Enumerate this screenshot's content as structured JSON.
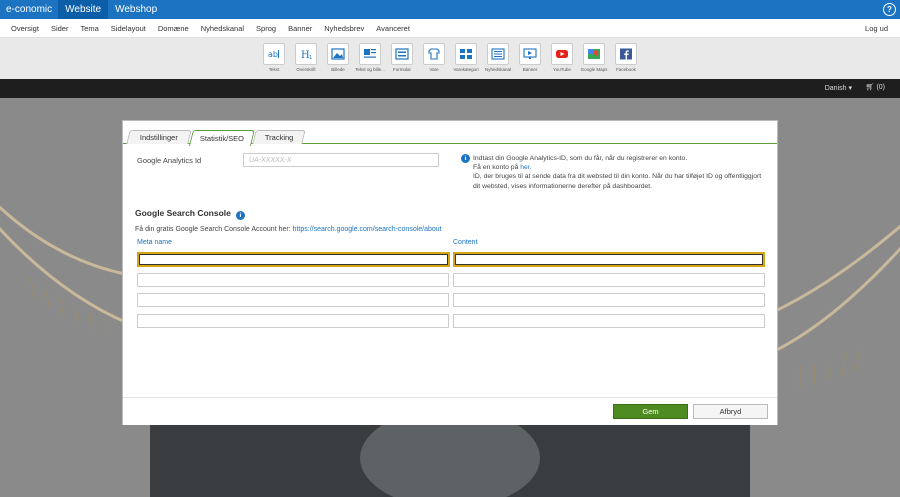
{
  "topbar": {
    "brand": "e-conomic",
    "tabs": [
      "Website",
      "Webshop"
    ],
    "help_glyph": "?"
  },
  "subnav": {
    "items": [
      "Oversigt",
      "Sider",
      "Tema",
      "Sidelayout",
      "Domæne",
      "Nyhedskanal",
      "Sprog",
      "Banner",
      "Nyhedsbrev",
      "Avanceret"
    ],
    "logout": "Log ud"
  },
  "toolbar": {
    "tools": [
      {
        "label": "Tekst",
        "icon": "text-icon"
      },
      {
        "label": "Overskrift",
        "icon": "heading-icon"
      },
      {
        "label": "Billede",
        "icon": "image-icon"
      },
      {
        "label": "Tekst og bille...",
        "icon": "text-image-icon"
      },
      {
        "label": "Formular",
        "icon": "form-icon"
      },
      {
        "label": "Vare",
        "icon": "product-icon"
      },
      {
        "label": "Varekategori",
        "icon": "category-icon"
      },
      {
        "label": "Nyhedskanal",
        "icon": "news-icon"
      },
      {
        "label": "Banner",
        "icon": "banner-icon"
      },
      {
        "label": "YouTube",
        "icon": "youtube-icon"
      },
      {
        "label": "Google Maps",
        "icon": "maps-icon"
      },
      {
        "label": "Facebook",
        "icon": "facebook-icon"
      }
    ]
  },
  "sitehead": {
    "language": "Danish",
    "cart_count": "(0)"
  },
  "modal": {
    "tabs": [
      "Indstillinger",
      "Statistik/SEO",
      "Tracking"
    ],
    "analytics_label": "Google Analytics Id",
    "analytics_placeholder": "UA-XXXXX-X",
    "info_glyph": "i",
    "info_line1": "Indtast din Google Analytics-ID, som du får, når du registrerer en konto.",
    "info_line2_pre": "Få en konto på ",
    "info_line2_link": "her",
    "info_line2_post": ".",
    "info_line3": "ID, der bruges til at sende data fra dit websted til din konto. Når du har tilføjet ID og offentliggjort dit websted, vises informationerne derefter på dashboardet.",
    "gsc_title": "Google Search Console",
    "gsc_account_text": "Få din gratis Google Search Console Account her: ",
    "gsc_link": "https://search.google.com/search-console/about",
    "col_meta": "Meta name",
    "col_content": "Content",
    "save": "Gem",
    "cancel": "Afbryd"
  },
  "colors": {
    "topbar": "#1c73c2",
    "accent_green": "#5c9e3a",
    "save_button": "#4e8b21",
    "link": "#1c73c2",
    "focus_border": "#d5a612"
  }
}
